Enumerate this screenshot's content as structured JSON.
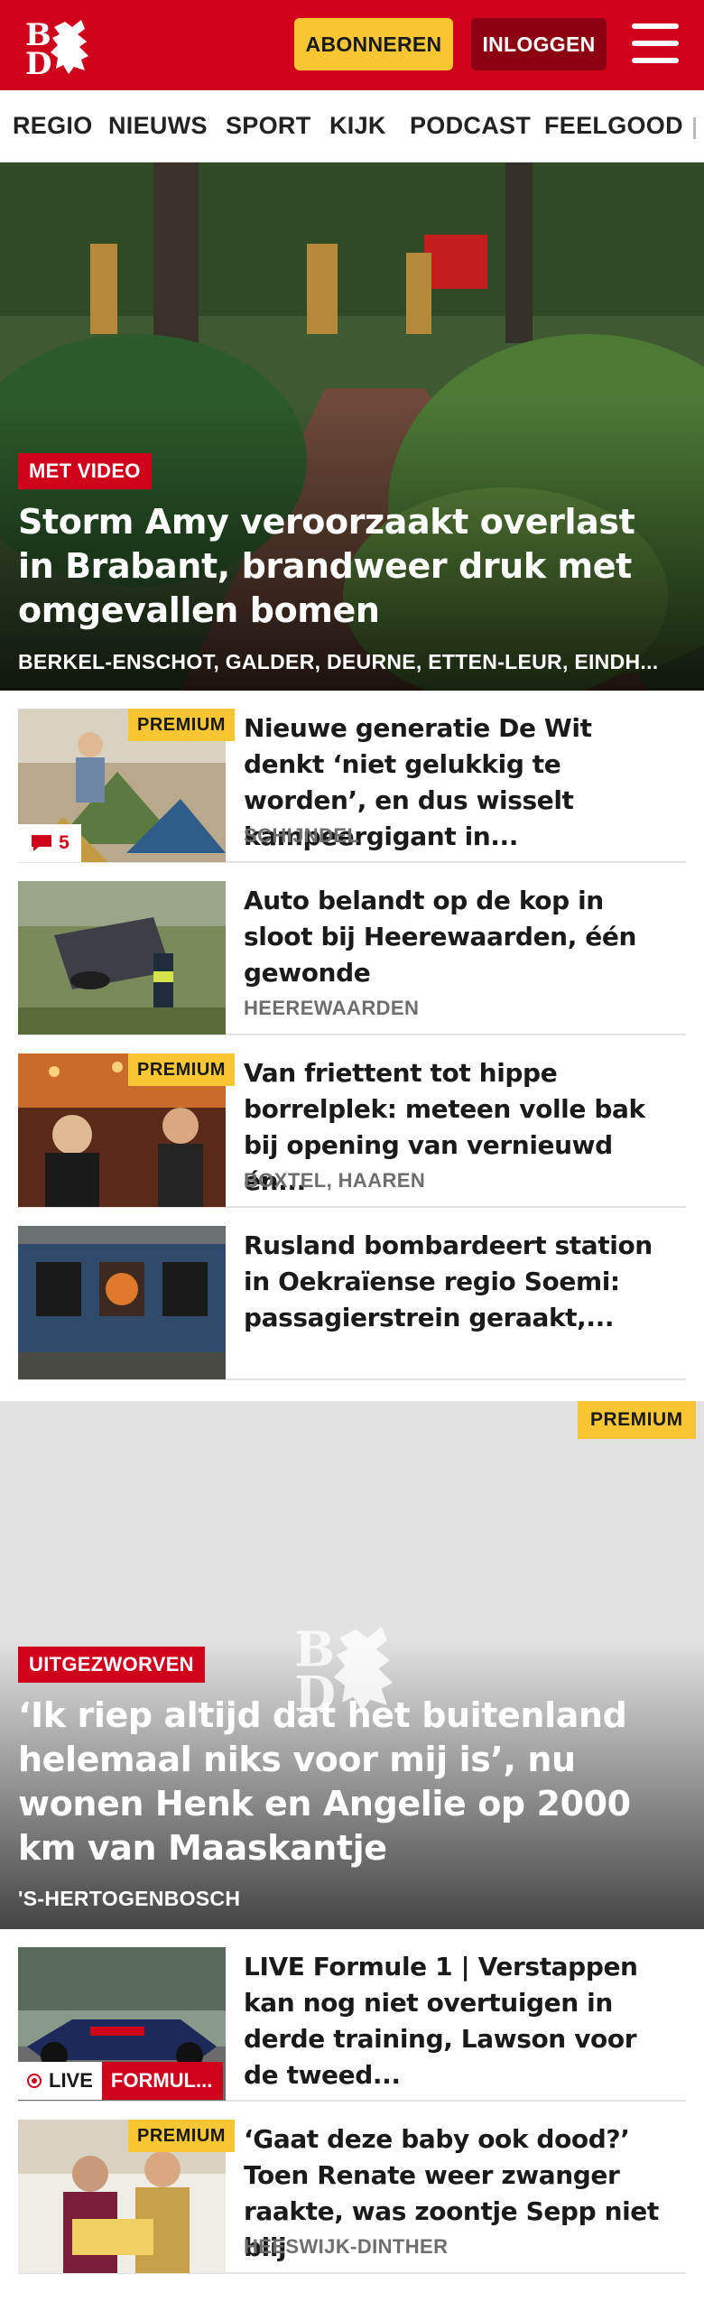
{
  "header": {
    "logo_alt": "BD",
    "subscribe_label": "ABONNEREN",
    "login_label": "INLOGGEN"
  },
  "nav": {
    "items": [
      "REGIO",
      "NIEUWS",
      "SPORT",
      "KIJK",
      "PODCAST",
      "FEELGOOD"
    ]
  },
  "hero": {
    "badge": "MET VIDEO",
    "title": "Storm Amy veroorzaakt overlast in Brabant, brandweer druk met omgevallen bomen",
    "location": "BERKEL-ENSCHOT, GALDER, DEURNE, ETTEN-LEUR, EINDH..."
  },
  "articles": [
    {
      "premium": "PREMIUM",
      "title": "Nieuwe generatie De Wit denkt ‘niet gelukkig te worden’, en dus wisselt kampeergigant in...",
      "location": "SCHIJNDEL",
      "comments": "5"
    },
    {
      "title": "Auto belandt op de kop in sloot bij Heerewaarden, één gewonde",
      "location": "HEEREWAARDEN"
    },
    {
      "premium": "PREMIUM",
      "title": "Van friettent tot hippe borrelplek: meteen volle bak bij opening van vernieuwd én...",
      "location": "BOXTEL, HAAREN"
    },
    {
      "title": "Rusland bombardeert station in Oekraïense regio Soemi: passagierstrein geraakt,...",
      "location": ""
    }
  ],
  "hero2": {
    "premium": "PREMIUM",
    "badge": "UITGEZWORVEN",
    "title": "‘Ik riep altijd dat het buitenland helemaal niks voor mij is’, nu wonen Henk en Angelie op 2000 km van Maaskantje",
    "location": "'S-HERTOGENBOSCH"
  },
  "articles2": [
    {
      "live": "LIVE",
      "live_category": "FORMUL...",
      "title": "LIVE Formule 1 | Verstappen kan nog niet overtuigen in derde training, Lawson voor de tweed...",
      "location": ""
    },
    {
      "premium": "PREMIUM",
      "title": "‘Gaat deze baby ook dood?’ Toen Renate weer zwanger raakte, was zoontje Sepp niet blij",
      "location": "HEESWIJK-DINTHER"
    }
  ],
  "colors": {
    "brand_red": "#d0021b",
    "premium_yellow": "#f7c632",
    "login_dark_red": "#8c0011"
  }
}
